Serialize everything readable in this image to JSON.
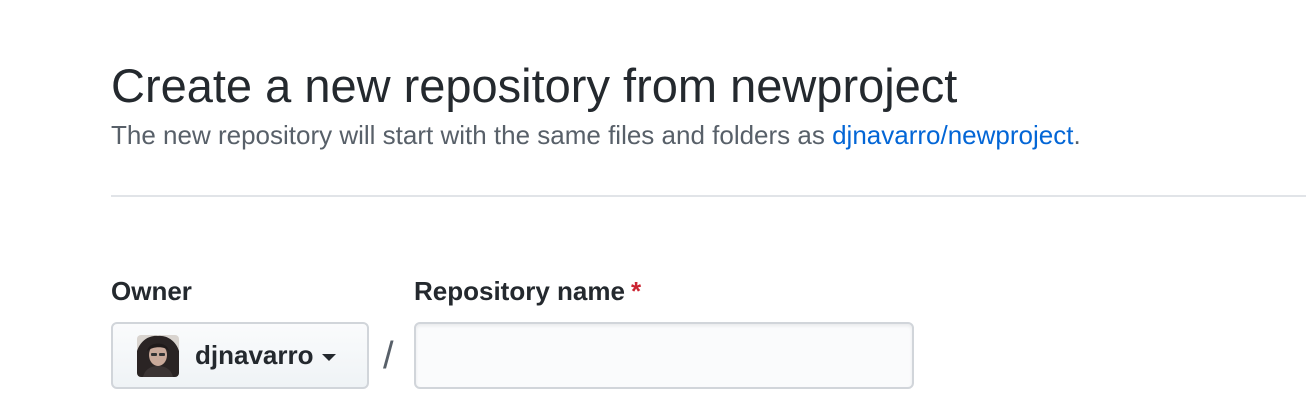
{
  "header": {
    "title": "Create a new repository from newproject",
    "subtitle_prefix": "The new repository will start with the same files and folders as ",
    "template_link": "djnavarro/newproject",
    "subtitle_suffix": "."
  },
  "form": {
    "owner_label": "Owner",
    "repo_name_label": "Repository name",
    "required_marker": "*",
    "owner_value": "djnavarro",
    "owner_avatar_icon": "user-avatar",
    "dropdown_icon": "caret-down-icon",
    "separator": "/",
    "repo_name_value": "",
    "repo_name_placeholder": ""
  },
  "colors": {
    "link": "#0366d6",
    "required": "#cb2431",
    "text": "#24292e",
    "muted": "#586069",
    "border": "#d1d5da"
  }
}
